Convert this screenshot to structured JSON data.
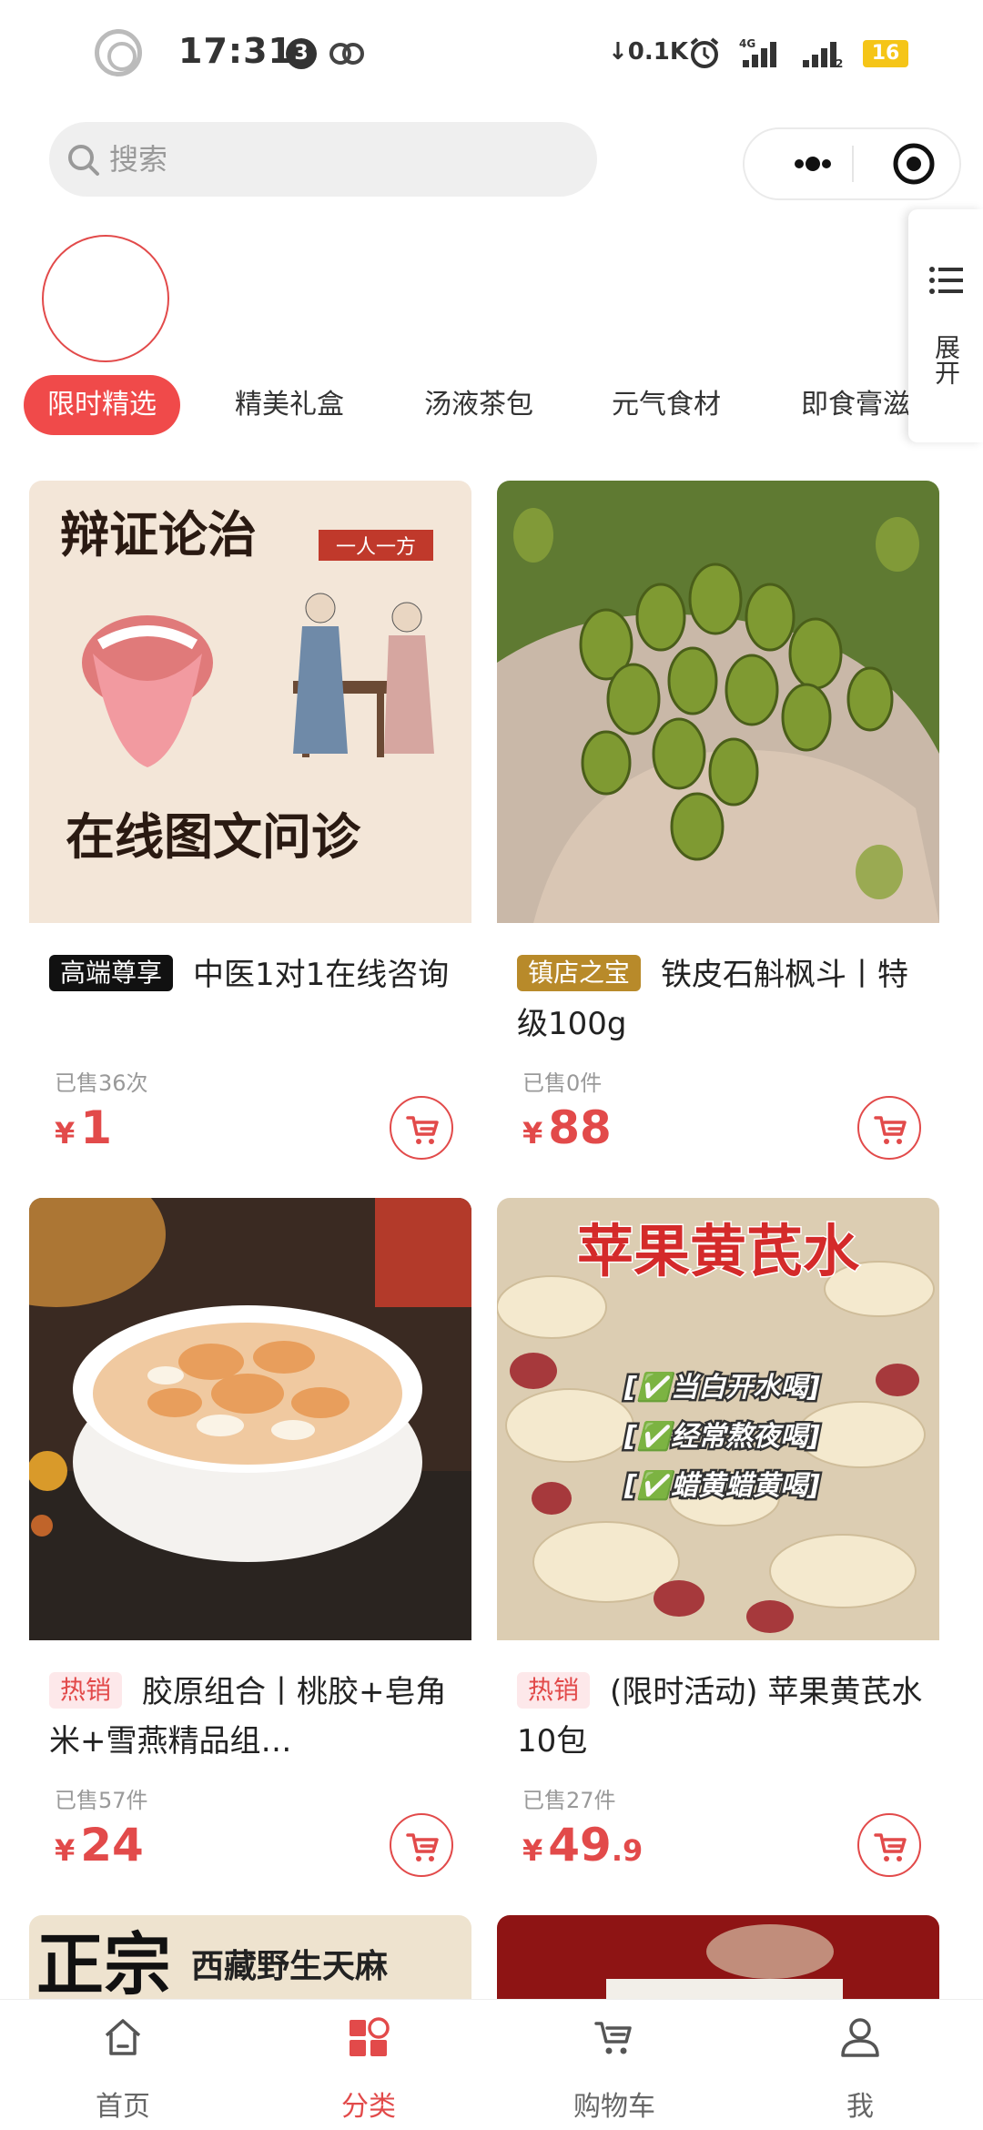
{
  "status_bar": {
    "time": "17:31",
    "notification_count": "3",
    "net_speed": "0.1K",
    "network_type": "4G",
    "battery": "16"
  },
  "search": {
    "placeholder": "搜索"
  },
  "expand_panel": {
    "label": "展开"
  },
  "category_tabs": [
    {
      "label": "限时精选",
      "active": true
    },
    {
      "label": "精美礼盒"
    },
    {
      "label": "汤液茶包"
    },
    {
      "label": "元气食材"
    },
    {
      "label": "即食膏滋"
    }
  ],
  "products": [
    {
      "tag": "高端尊享",
      "title": "中医1对1在线咨询",
      "sold": "已售36次",
      "price_symbol": "¥",
      "price_int": "1",
      "price_dec": "",
      "image_text": {
        "headline": "辩证论治",
        "stamp": "一人一方",
        "footer": "在线图文问诊"
      }
    },
    {
      "tag": "镇店之宝",
      "title": "铁皮石斛枫斗丨特级100g",
      "sold": "已售0件",
      "price_symbol": "¥",
      "price_int": "88",
      "price_dec": ""
    },
    {
      "tag": "热销",
      "title": "胶原组合丨桃胶+皂角米+雪燕精品组…",
      "sold": "已售57件",
      "price_symbol": "¥",
      "price_int": "24",
      "price_dec": ""
    },
    {
      "tag": "热销",
      "title": "(限时活动) 苹果黄芪水10包",
      "sold": "已售27件",
      "price_symbol": "¥",
      "price_int": "49",
      "price_dec": ".9",
      "image_text": {
        "headline": "苹果黄芪水",
        "line1": "[✅当白开水喝]",
        "line2": "[✅经常熬夜喝]",
        "line3": "[✅蜡黄蜡黄喝]"
      }
    }
  ],
  "peek_cards": {
    "left_text_main": "正宗",
    "left_text_sub": "西藏野生天麻"
  },
  "bottom_nav": [
    {
      "label": "首页",
      "icon": "home-icon"
    },
    {
      "label": "分类",
      "icon": "category-icon",
      "active": true
    },
    {
      "label": "购物车",
      "icon": "cart-icon"
    },
    {
      "label": "我",
      "icon": "user-icon"
    }
  ],
  "colors": {
    "accent": "#e24a4a",
    "tab_active": "#f04a4a"
  }
}
